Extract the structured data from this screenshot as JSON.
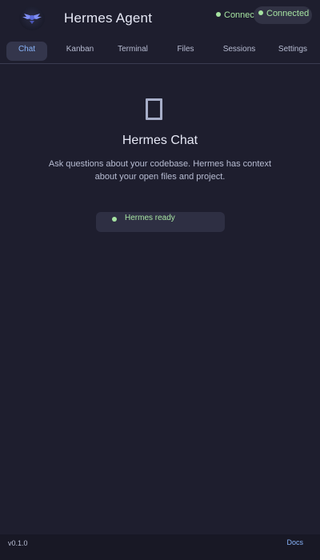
{
  "header": {
    "title": "Hermes Agent",
    "status_inline": "Connect",
    "status_pill": "Connected",
    "status_color": "#a6e3a1"
  },
  "tabs": [
    {
      "label": "Chat",
      "active": true
    },
    {
      "label": "Kanban",
      "active": false
    },
    {
      "label": "Terminal",
      "active": false
    },
    {
      "label": "Files",
      "active": false
    },
    {
      "label": "Sessions",
      "active": false
    },
    {
      "label": "Settings",
      "active": false
    }
  ],
  "chat": {
    "empty_icon": "document-outline-icon",
    "title": "Hermes Chat",
    "description": "Ask questions about your codebase. Hermes has context about your open files and project.",
    "ready_status": "Hermes ready"
  },
  "footer": {
    "version": "v0.1.0",
    "docs": "Docs"
  },
  "colors": {
    "background": "#1e1e2e",
    "accent": "#89b4fa",
    "success": "#a6e3a1"
  }
}
